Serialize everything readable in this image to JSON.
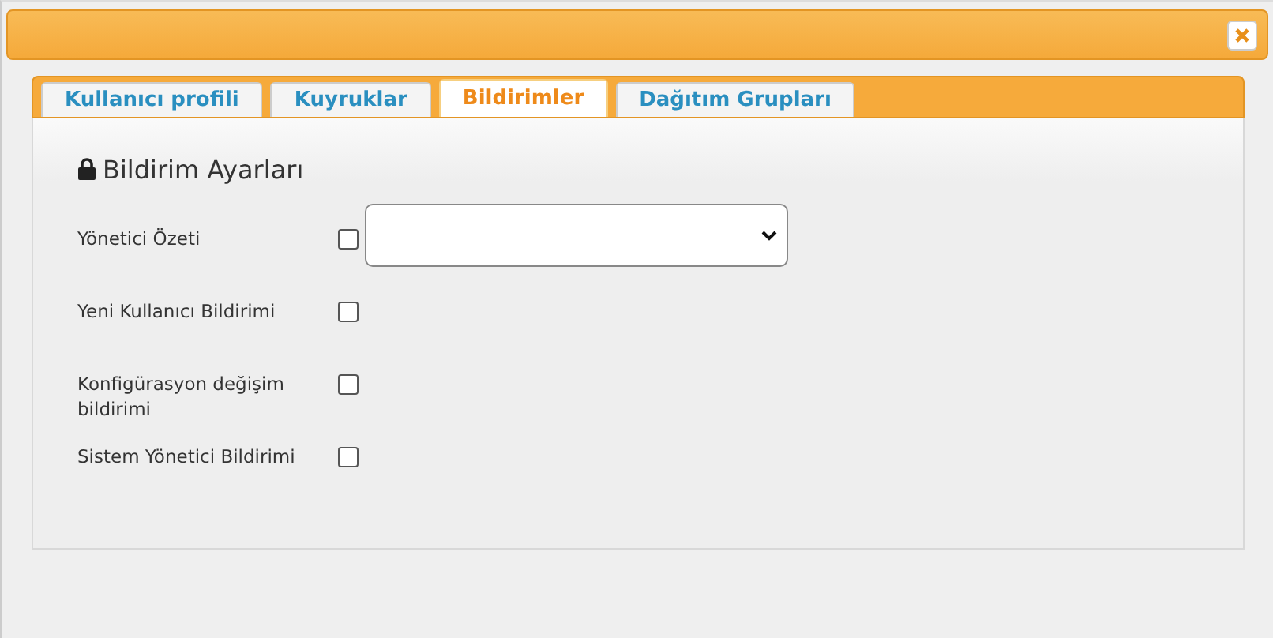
{
  "tabs": [
    {
      "label": "Kullanıcı profili",
      "selected": false
    },
    {
      "label": "Kuyruklar",
      "selected": false
    },
    {
      "label": "Bildirimler",
      "selected": true
    },
    {
      "label": "Dağıtım Grupları",
      "selected": false
    }
  ],
  "section": {
    "title": "Bildirim Ayarları"
  },
  "settings": [
    {
      "label": "Yönetici Özeti",
      "checked": false,
      "kind": "select"
    },
    {
      "label": "Yeni Kullanıcı Bildirimi",
      "checked": false,
      "kind": "checkbox"
    },
    {
      "label": "Konfigürasyon değişim bildirimi",
      "checked": false,
      "kind": "checkbox"
    },
    {
      "label": "Sistem Yönetici Bildirimi",
      "checked": false,
      "kind": "checkbox"
    }
  ]
}
